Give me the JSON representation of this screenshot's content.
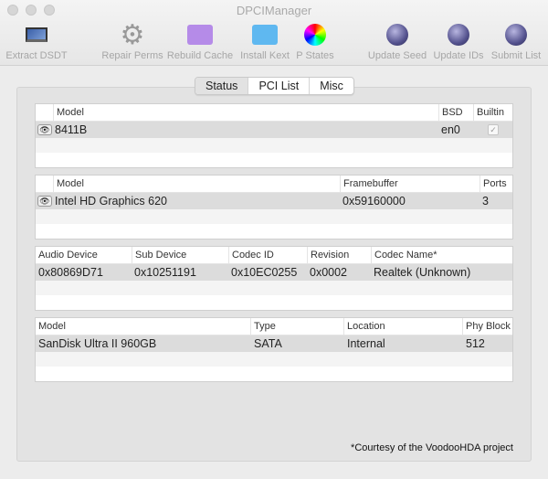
{
  "window": {
    "title": "DPCIManager"
  },
  "toolbar": [
    {
      "label": "Extract DSDT",
      "icon": "laptop-icon"
    },
    {
      "label": "Repair Perms",
      "icon": "gear-icon"
    },
    {
      "label": "Rebuild Cache",
      "icon": "folder-gear-icon"
    },
    {
      "label": "Install Kext",
      "icon": "folder-kext-icon"
    },
    {
      "label": "P States",
      "icon": "color-wheel-icon"
    },
    {
      "label": "Update Seed",
      "icon": "globe-icon"
    },
    {
      "label": "Update IDs",
      "icon": "globe-icon"
    },
    {
      "label": "Submit List",
      "icon": "globe-icon"
    }
  ],
  "tabs": [
    {
      "label": "Status",
      "active": true
    },
    {
      "label": "PCI List"
    },
    {
      "label": "Misc"
    }
  ],
  "network": {
    "headers": [
      "Model",
      "BSD",
      "Builtin"
    ],
    "rows": [
      {
        "model": "8411B",
        "bsd": "en0",
        "builtin": true
      }
    ]
  },
  "graphics": {
    "headers": [
      "Model",
      "Framebuffer",
      "Ports"
    ],
    "rows": [
      {
        "model": "Intel HD Graphics 620",
        "framebuffer": "0x59160000",
        "ports": "3"
      }
    ]
  },
  "audio": {
    "headers": [
      "Audio Device",
      "Sub Device",
      "Codec ID",
      "Revision",
      "Codec Name*"
    ],
    "rows": [
      {
        "device": "0x80869D71",
        "sub": "0x10251191",
        "codec": "0x10EC0255",
        "rev": "0x0002",
        "name": "Realtek (Unknown)"
      }
    ]
  },
  "storage": {
    "headers": [
      "Model",
      "Type",
      "Location",
      "Phy Block"
    ],
    "rows": [
      {
        "model": "SanDisk Ultra II 960GB",
        "type": "SATA",
        "location": "Internal",
        "block": "512"
      }
    ]
  },
  "footer": "*Courtesy of the VoodooHDA project"
}
